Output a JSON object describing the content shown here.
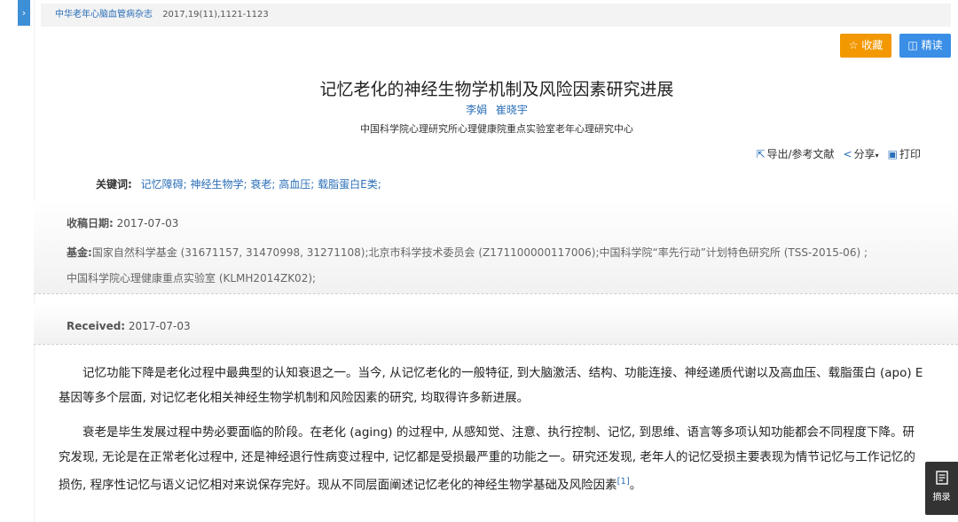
{
  "header": {
    "journal": "中华老年心脑血管病杂志",
    "citation": "2017,19(11),1121-1123"
  },
  "actions": {
    "collect_label": "收藏",
    "intensive_read_label": "精读"
  },
  "article": {
    "title": "记忆老化的神经生物学机制及风险因素研究进展",
    "authors": [
      "李娟",
      "崔晓宇"
    ],
    "affiliation": "中国科学院心理研究所心理健康院重点实验室老年心理研究中心"
  },
  "tools": {
    "export_label": "导出/参考文献",
    "share_label": "分享",
    "print_label": "打印"
  },
  "keywords": {
    "label": "关键词:",
    "items": [
      "记忆障碍;",
      "神经生物学;",
      "衰老;",
      "高血压;",
      "载脂蛋白E类;"
    ]
  },
  "meta": {
    "received_label": "收稿日期:",
    "received_value": "2017-07-03",
    "fund_label": "基金:",
    "fund_line1": "国家自然科学基金 (31671157, 31470998, 31271108);北京市科学技术委员会 (Z171100000117006);中国科学院“率先行动”计划特色研究所 (TSS-2015-06) ;",
    "fund_line2": "中国科学院心理健康重点实验室 (KLMH2014ZK02);"
  },
  "received_en": {
    "label": "Received:",
    "value": "2017-07-03"
  },
  "body": {
    "paragraph1": "记忆功能下降是老化过程中最典型的认知衰退之一。当今, 从记忆老化的一般特征, 到大脑激活、结构、功能连接、神经递质代谢以及高血压、载脂蛋白 (apo) E基因等多个层面, 对记忆老化相关神经生物学机制和风险因素的研究, 均取得许多新进展。",
    "paragraph2": "衰老是毕生发展过程中势必要面临的阶段。在老化 (aging) 的过程中, 从感知觉、注意、执行控制、记忆, 到思维、语言等多项认知功能都会不同程度下降。研究发现, 无论是在正常老化过程中, 还是神经退行性病变过程中, 记忆都是受损最严重的功能之一。研究还发现, 老年人的记忆受损主要表现为情节记忆与工作记忆的损伤, 程序性记忆与语义记忆相对来说保存完好。现从不同层面阐述记忆老化的神经生物学基础及风险因素",
    "ref": "[1]",
    "tail": "。"
  },
  "side": {
    "abstract_label": "摘录"
  }
}
